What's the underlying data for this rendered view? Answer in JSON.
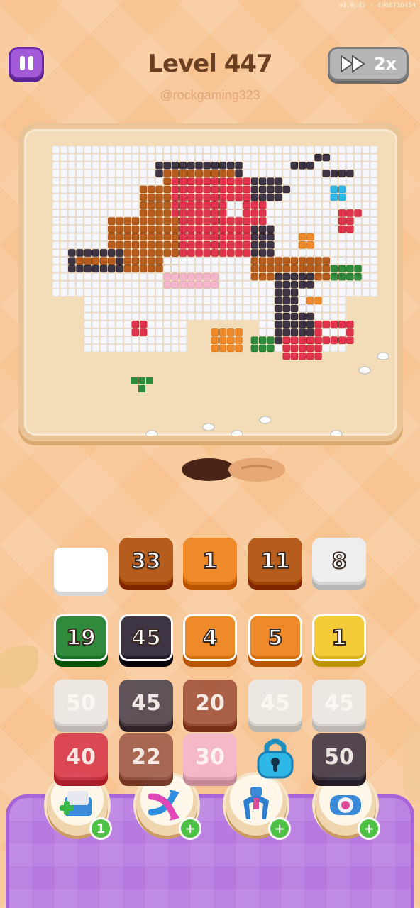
{
  "version": "v1.0.42 - 4908736454",
  "level_title": "Level 447",
  "watermark": "@rockgaming323",
  "speed_label": "2x",
  "icons": {
    "pause": "pause-icon",
    "speed": "fast-forward-icon",
    "lock": "lock-icon"
  },
  "slot_row": [
    {
      "type": "empty"
    },
    {
      "type": "tile",
      "label": "33",
      "color": "#b65c1c"
    },
    {
      "type": "tile",
      "label": "1",
      "color": "#ef8a2a"
    },
    {
      "type": "tile",
      "label": "11",
      "color": "#b65c1c"
    },
    {
      "type": "tile",
      "label": "8",
      "color": "#eeeeee"
    }
  ],
  "grid": [
    [
      {
        "label": "19",
        "color": "#2f8a3c",
        "active": true
      },
      {
        "label": "45",
        "color": "#3d3444",
        "active": true
      },
      {
        "label": "4",
        "color": "#ef8a2a",
        "active": true
      },
      {
        "label": "5",
        "color": "#ef8a2a",
        "active": true
      },
      {
        "label": "1",
        "color": "#f4cc3a",
        "active": true
      }
    ],
    [
      {
        "label": "50",
        "color": "#ececec",
        "active": false
      },
      {
        "label": "45",
        "color": "#4a4350",
        "active": false
      },
      {
        "label": "20",
        "color": "#a0523b",
        "active": false
      },
      {
        "label": "45",
        "color": "#ececec",
        "active": false
      },
      {
        "label": "45",
        "color": "#ececec",
        "active": false
      }
    ],
    [
      {
        "label": "40",
        "color": "#d8374a",
        "active": false
      },
      {
        "label": "22",
        "color": "#9c5a48",
        "active": false
      },
      {
        "label": "30",
        "color": "#f5b6cd",
        "active": false
      },
      {
        "label": "",
        "color": "#2fb7e8",
        "active": false,
        "locked": true
      },
      {
        "label": "50",
        "color": "#3d3444",
        "active": false
      }
    ]
  ],
  "boosters": [
    {
      "name": "add-slot",
      "icon": "add-box-icon",
      "badge": "1"
    },
    {
      "name": "shuffle",
      "icon": "shuffle-arrows-icon",
      "badge": "+"
    },
    {
      "name": "magnet",
      "icon": "magnet-claw-icon",
      "badge": "+"
    },
    {
      "name": "paint",
      "icon": "paint-roller-icon",
      "badge": "+"
    }
  ],
  "colors": {
    "background": "#f7c492",
    "board": "#f3dcb8",
    "dock": "#b77ae0",
    "pause": "#a35ad8",
    "robin_red": "#e0334d",
    "robin_brown": "#b65c1c",
    "dark": "#3d3444"
  }
}
